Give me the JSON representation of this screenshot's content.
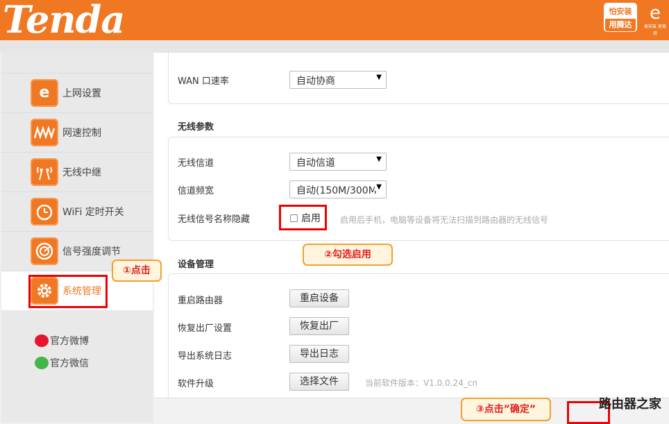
{
  "header": {
    "logo_text": "Tenda",
    "badge_line1": "怕安装",
    "badge_line2": "用腾达",
    "easy_logo_mark": "e",
    "easy_logo_small": "易安装 更易用"
  },
  "colors": {
    "accent": "#f07823",
    "annotation_red": "#e00000"
  },
  "sidebar": {
    "items": [
      {
        "label": "上网设置",
        "icon": "internet-icon"
      },
      {
        "label": "网速控制",
        "icon": "speed-icon"
      },
      {
        "label": "无线中继",
        "icon": "wireless-repeater-icon"
      },
      {
        "label": "WiFi 定时开关",
        "icon": "wifi-timer-icon"
      },
      {
        "label": "信号强度调节",
        "icon": "signal-strength-icon"
      },
      {
        "label": "系统管理",
        "icon": "gear-icon"
      }
    ],
    "weibo": "官方微博",
    "wechat": "官方微信"
  },
  "wan": {
    "label": "WAN 口速率",
    "value": "自动协商"
  },
  "wireless": {
    "title": "无线参数",
    "channel_label": "无线信道",
    "channel_value": "自动信道",
    "bandwidth_label": "信道频宽",
    "bandwidth_value": "自动(150M/300M",
    "hide_ssid_label": "无线信号名称隐藏",
    "hide_ssid_checkbox": "启用",
    "hide_ssid_hint": "启用后手机，电脑等设备将无法扫描到路由器的无线信号"
  },
  "device": {
    "title": "设备管理",
    "reboot_label": "重启路由器",
    "reboot_btn": "重启设备",
    "reset_label": "恢复出厂设置",
    "reset_btn": "恢复出厂",
    "log_label": "导出系统日志",
    "log_btn": "导出日志",
    "upgrade_label": "软件升级",
    "upgrade_btn": "选择文件",
    "version": "当前软件版本：V1.0.0.24_cn"
  },
  "annotations": {
    "step1": "①点击",
    "step2": "②勾选启用",
    "step3": "③点击”确定”",
    "watermark": "路由器之家"
  }
}
